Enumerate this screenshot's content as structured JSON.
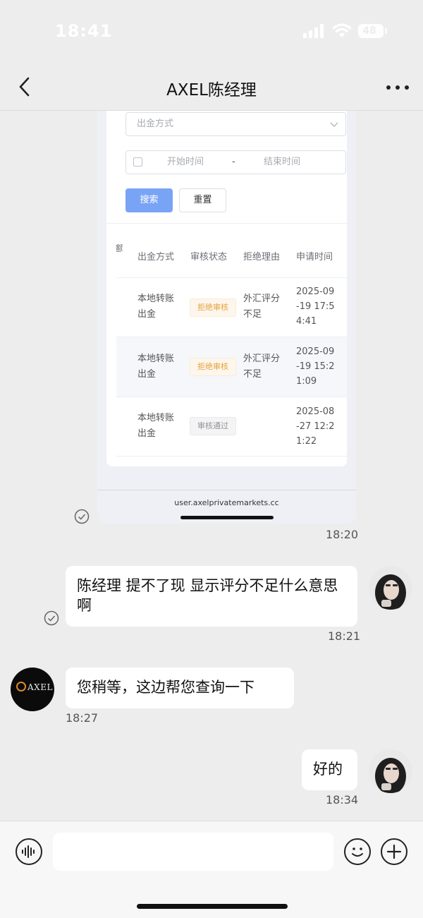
{
  "status": {
    "time": "18:41",
    "battery": "48"
  },
  "nav": {
    "title": "AXEL陈经理"
  },
  "shot": {
    "select_placeholder": "出金方式",
    "date_start": "开始时间",
    "date_sep": "-",
    "date_end": "结束时间",
    "search_label": "搜索",
    "reset_label": "重置",
    "columns": [
      "额",
      "出金方式",
      "审核状态",
      "拒绝理由",
      "申请时间"
    ],
    "rows": [
      {
        "method": "本地转账出金",
        "status": "拒绝审核",
        "reason": "外汇评分不足",
        "time": "2025-09-19 17:54:41"
      },
      {
        "method": "本地转账出金",
        "status": "拒绝审核",
        "reason": "外汇评分不足",
        "time": "2025-09-19 15:21:09"
      },
      {
        "method": "本地转账出金",
        "status": "审核通过",
        "reason": "",
        "time": "2025-08-27 12:21:22"
      }
    ],
    "url": "user.axelprivatemarkets.cc"
  },
  "messages": {
    "shot_time": "18:20",
    "m1_text": "陈经理  提不了现  显示评分不足什么意思啊",
    "m1_time": "18:21",
    "m2_text": "您稍等，这边帮您查询一下",
    "m2_time": "18:27",
    "m3_text": "好的",
    "m3_time": "18:34"
  },
  "brand": {
    "avatar_text": "AXEL"
  }
}
